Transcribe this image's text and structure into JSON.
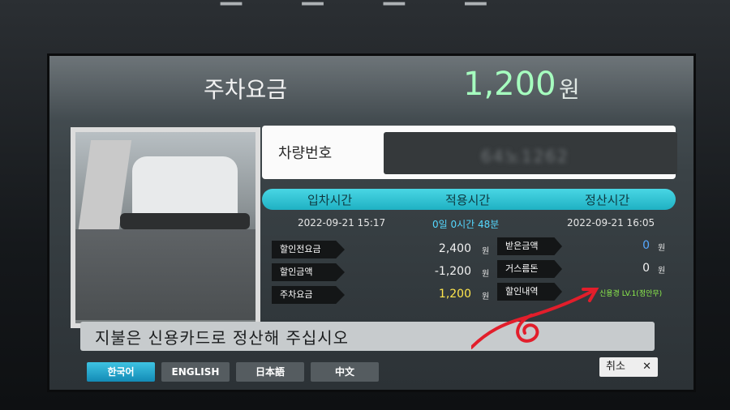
{
  "header": {
    "title": "주차요금",
    "amount": "1,200",
    "unit": "원"
  },
  "vehicle": {
    "plate_label": "차량번호",
    "plate_value": "64노1262"
  },
  "times": {
    "headers": [
      "입차시간",
      "적용시간",
      "정산시간"
    ],
    "entry": "2022-09-21 15:17",
    "applied": "0일 0시간 48분",
    "exit": "2022-09-21 16:05"
  },
  "fees": {
    "before_discount_label": "할인전요금",
    "before_discount_value": "2,400",
    "discount_label": "할인금액",
    "discount_value": "-1,200",
    "parking_label": "주차요금",
    "parking_value": "1,200",
    "won": "원"
  },
  "payment": {
    "received_label": "받은금액",
    "received_value": "0",
    "change_label": "거스름돈",
    "change_value": "0",
    "discount_detail_label": "할인내역",
    "discount_detail_value": "신용경 LV.1(정안무)",
    "won": "원"
  },
  "message": "지불은 신용카드로 정산해 주십시오",
  "languages": [
    "한국어",
    "ENGLISH",
    "日本語",
    "中文"
  ],
  "cancel": {
    "label": "취소",
    "icon": "close-icon"
  },
  "colors": {
    "accent": "#1fb1c3",
    "amount_green": "#a6ffbf",
    "fee_yellow": "#ffe64d",
    "received_blue": "#55a8ff",
    "note_green": "#8ef04d"
  }
}
